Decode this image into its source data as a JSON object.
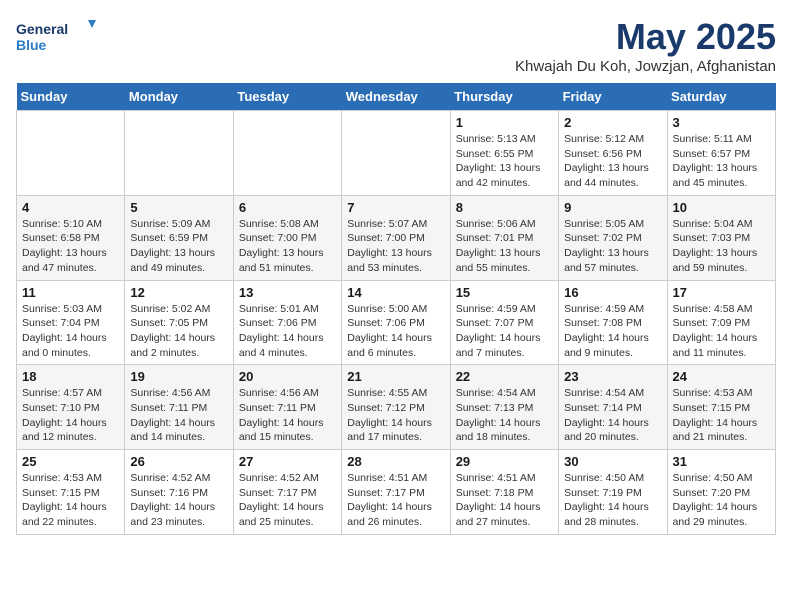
{
  "logo": {
    "line1": "General",
    "line2": "Blue"
  },
  "title": "May 2025",
  "location": "Khwajah Du Koh, Jowzjan, Afghanistan",
  "days_of_week": [
    "Sunday",
    "Monday",
    "Tuesday",
    "Wednesday",
    "Thursday",
    "Friday",
    "Saturday"
  ],
  "weeks": [
    [
      {
        "day": "",
        "info": ""
      },
      {
        "day": "",
        "info": ""
      },
      {
        "day": "",
        "info": ""
      },
      {
        "day": "",
        "info": ""
      },
      {
        "day": "1",
        "info": "Sunrise: 5:13 AM\nSunset: 6:55 PM\nDaylight: 13 hours\nand 42 minutes."
      },
      {
        "day": "2",
        "info": "Sunrise: 5:12 AM\nSunset: 6:56 PM\nDaylight: 13 hours\nand 44 minutes."
      },
      {
        "day": "3",
        "info": "Sunrise: 5:11 AM\nSunset: 6:57 PM\nDaylight: 13 hours\nand 45 minutes."
      }
    ],
    [
      {
        "day": "4",
        "info": "Sunrise: 5:10 AM\nSunset: 6:58 PM\nDaylight: 13 hours\nand 47 minutes."
      },
      {
        "day": "5",
        "info": "Sunrise: 5:09 AM\nSunset: 6:59 PM\nDaylight: 13 hours\nand 49 minutes."
      },
      {
        "day": "6",
        "info": "Sunrise: 5:08 AM\nSunset: 7:00 PM\nDaylight: 13 hours\nand 51 minutes."
      },
      {
        "day": "7",
        "info": "Sunrise: 5:07 AM\nSunset: 7:00 PM\nDaylight: 13 hours\nand 53 minutes."
      },
      {
        "day": "8",
        "info": "Sunrise: 5:06 AM\nSunset: 7:01 PM\nDaylight: 13 hours\nand 55 minutes."
      },
      {
        "day": "9",
        "info": "Sunrise: 5:05 AM\nSunset: 7:02 PM\nDaylight: 13 hours\nand 57 minutes."
      },
      {
        "day": "10",
        "info": "Sunrise: 5:04 AM\nSunset: 7:03 PM\nDaylight: 13 hours\nand 59 minutes."
      }
    ],
    [
      {
        "day": "11",
        "info": "Sunrise: 5:03 AM\nSunset: 7:04 PM\nDaylight: 14 hours\nand 0 minutes."
      },
      {
        "day": "12",
        "info": "Sunrise: 5:02 AM\nSunset: 7:05 PM\nDaylight: 14 hours\nand 2 minutes."
      },
      {
        "day": "13",
        "info": "Sunrise: 5:01 AM\nSunset: 7:06 PM\nDaylight: 14 hours\nand 4 minutes."
      },
      {
        "day": "14",
        "info": "Sunrise: 5:00 AM\nSunset: 7:06 PM\nDaylight: 14 hours\nand 6 minutes."
      },
      {
        "day": "15",
        "info": "Sunrise: 4:59 AM\nSunset: 7:07 PM\nDaylight: 14 hours\nand 7 minutes."
      },
      {
        "day": "16",
        "info": "Sunrise: 4:59 AM\nSunset: 7:08 PM\nDaylight: 14 hours\nand 9 minutes."
      },
      {
        "day": "17",
        "info": "Sunrise: 4:58 AM\nSunset: 7:09 PM\nDaylight: 14 hours\nand 11 minutes."
      }
    ],
    [
      {
        "day": "18",
        "info": "Sunrise: 4:57 AM\nSunset: 7:10 PM\nDaylight: 14 hours\nand 12 minutes."
      },
      {
        "day": "19",
        "info": "Sunrise: 4:56 AM\nSunset: 7:11 PM\nDaylight: 14 hours\nand 14 minutes."
      },
      {
        "day": "20",
        "info": "Sunrise: 4:56 AM\nSunset: 7:11 PM\nDaylight: 14 hours\nand 15 minutes."
      },
      {
        "day": "21",
        "info": "Sunrise: 4:55 AM\nSunset: 7:12 PM\nDaylight: 14 hours\nand 17 minutes."
      },
      {
        "day": "22",
        "info": "Sunrise: 4:54 AM\nSunset: 7:13 PM\nDaylight: 14 hours\nand 18 minutes."
      },
      {
        "day": "23",
        "info": "Sunrise: 4:54 AM\nSunset: 7:14 PM\nDaylight: 14 hours\nand 20 minutes."
      },
      {
        "day": "24",
        "info": "Sunrise: 4:53 AM\nSunset: 7:15 PM\nDaylight: 14 hours\nand 21 minutes."
      }
    ],
    [
      {
        "day": "25",
        "info": "Sunrise: 4:53 AM\nSunset: 7:15 PM\nDaylight: 14 hours\nand 22 minutes."
      },
      {
        "day": "26",
        "info": "Sunrise: 4:52 AM\nSunset: 7:16 PM\nDaylight: 14 hours\nand 23 minutes."
      },
      {
        "day": "27",
        "info": "Sunrise: 4:52 AM\nSunset: 7:17 PM\nDaylight: 14 hours\nand 25 minutes."
      },
      {
        "day": "28",
        "info": "Sunrise: 4:51 AM\nSunset: 7:17 PM\nDaylight: 14 hours\nand 26 minutes."
      },
      {
        "day": "29",
        "info": "Sunrise: 4:51 AM\nSunset: 7:18 PM\nDaylight: 14 hours\nand 27 minutes."
      },
      {
        "day": "30",
        "info": "Sunrise: 4:50 AM\nSunset: 7:19 PM\nDaylight: 14 hours\nand 28 minutes."
      },
      {
        "day": "31",
        "info": "Sunrise: 4:50 AM\nSunset: 7:20 PM\nDaylight: 14 hours\nand 29 minutes."
      }
    ]
  ]
}
